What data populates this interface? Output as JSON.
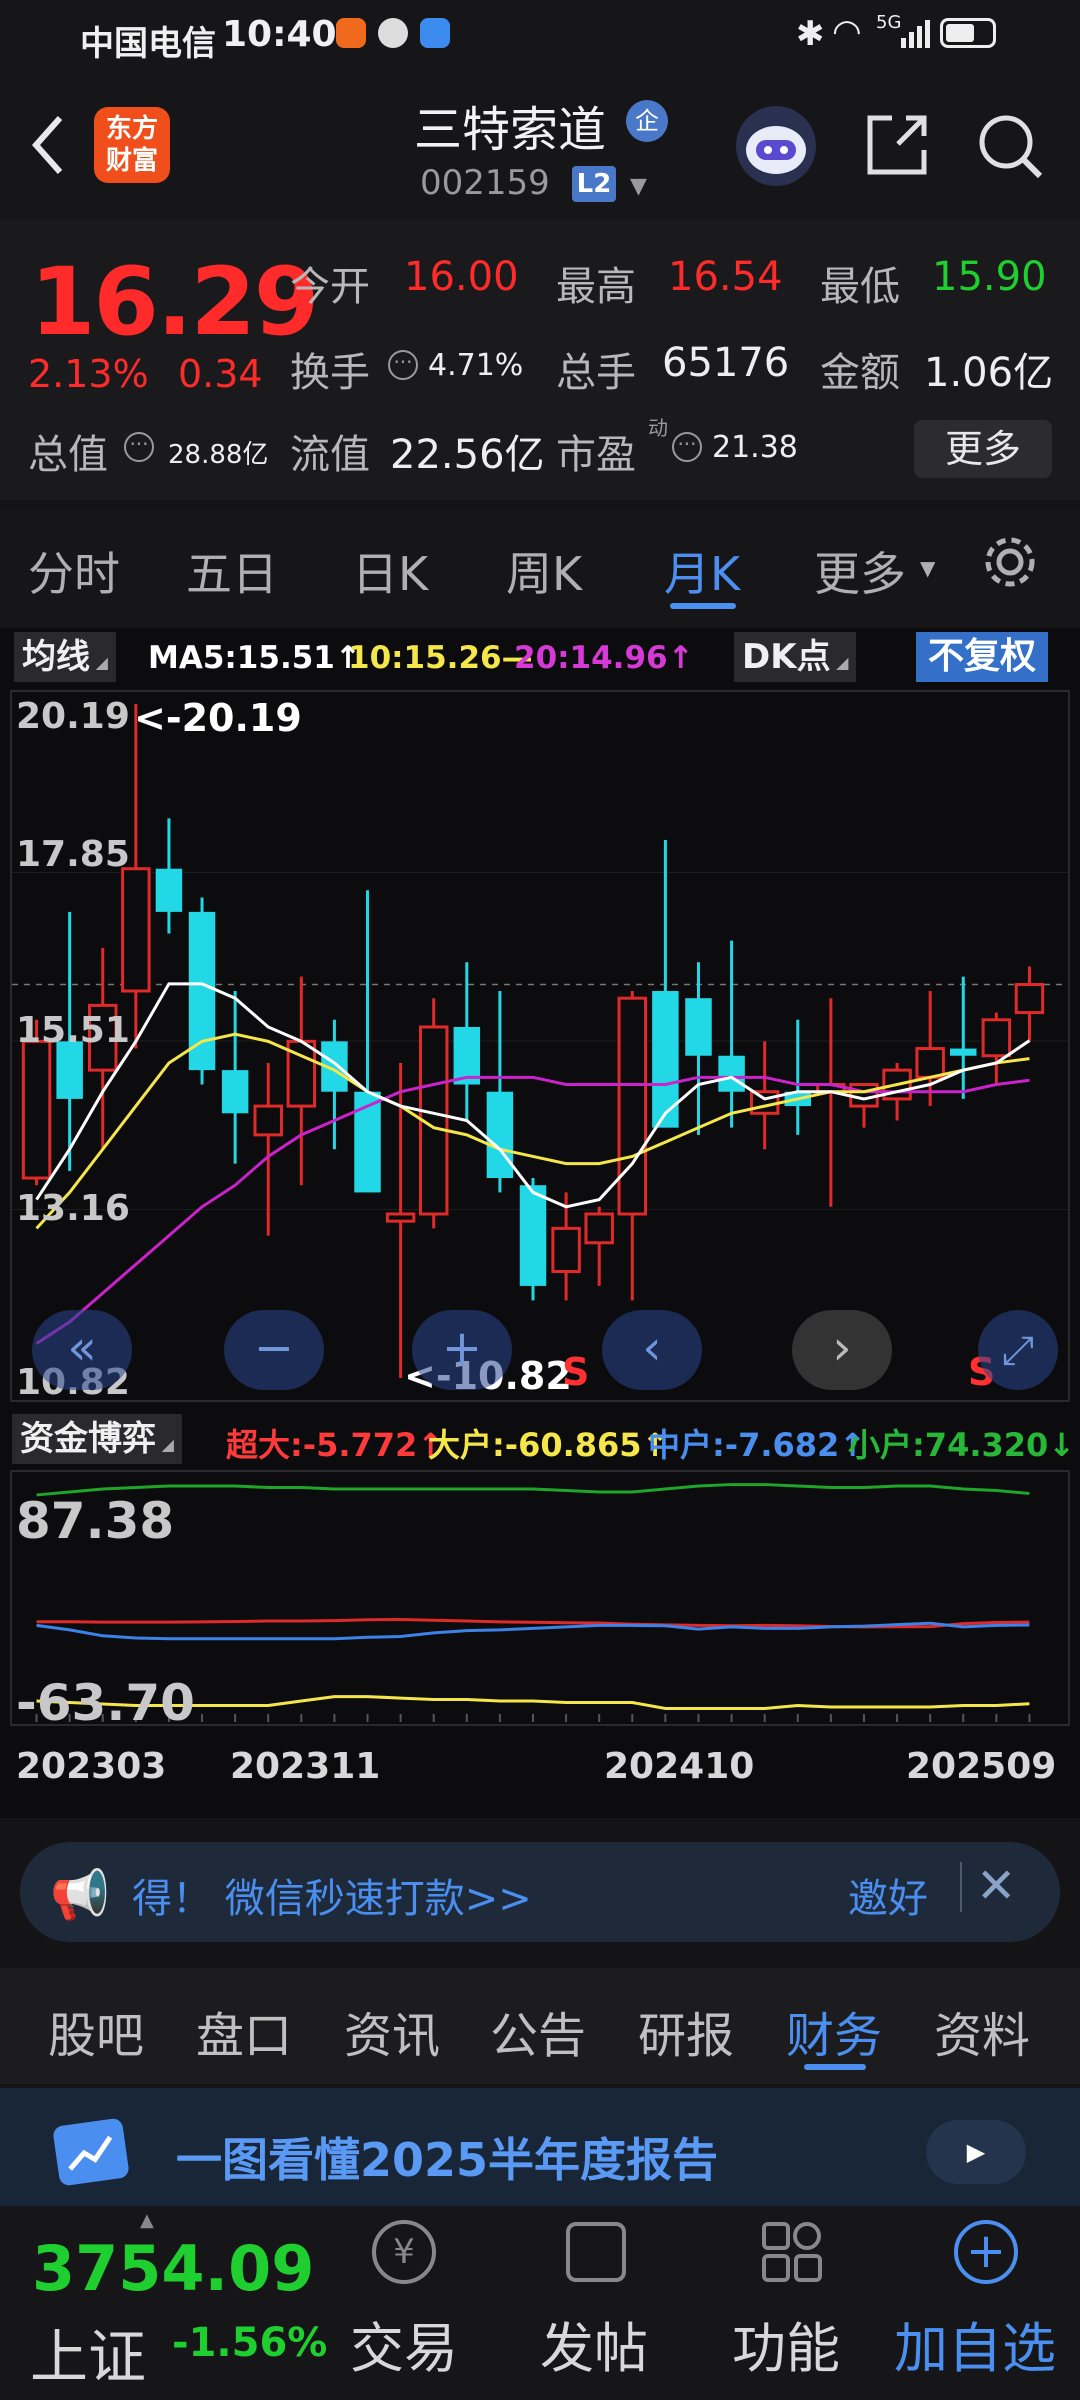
{
  "status_bar": {
    "carrier": "中国电信",
    "time": "10:40",
    "network": "5G"
  },
  "header": {
    "brand_line1": "东方",
    "brand_line2": "财富",
    "stock_name": "三特索道",
    "badge": "企",
    "stock_code": "002159",
    "level_badge": "L2"
  },
  "quote": {
    "price": "16.29",
    "change_pct": "2.13%",
    "change_amt": "0.34",
    "open_label": "今开",
    "open": "16.00",
    "high_label": "最高",
    "high": "16.54",
    "low_label": "最低",
    "low": "15.90",
    "turnover_label": "换手",
    "turnover": "4.71%",
    "volume_label": "总手",
    "volume": "65176",
    "amount_label": "金额",
    "amount": "1.06亿",
    "mktcap_label": "总值",
    "mktcap": "28.88亿",
    "float_label": "流值",
    "float": "22.56亿",
    "pe_label": "市盈",
    "pe_sup": "动",
    "pe": "21.38",
    "more_button": "更多"
  },
  "period_tabs": [
    "分时",
    "五日",
    "日K",
    "周K",
    "月K",
    "更多"
  ],
  "active_tab": "月K",
  "chart": {
    "indicator_tag": "均线",
    "ma5": "MA5:15.51↑",
    "ma10": "10:15.26—",
    "ma20": "20:14.96↑",
    "dk_button": "DK点",
    "adj_button": "不复权",
    "y_labels": [
      "20.19",
      "17.85",
      "15.51",
      "13.16",
      "10.82"
    ],
    "max_marker": "<-20.19",
    "min_marker": "<-10.82",
    "s_marker": "S",
    "colors": {
      "up": "#e02a2a",
      "down": "#22d8e6",
      "ma5": "#ffffff",
      "ma10": "#f5e64a",
      "ma20": "#cc22cc"
    }
  },
  "chart_data": {
    "type": "candlestick",
    "ylim": [
      10.82,
      20.19
    ],
    "candles": [
      {
        "o": 13.6,
        "h": 15.8,
        "l": 13.5,
        "c": 15.5
      },
      {
        "o": 15.5,
        "h": 17.3,
        "l": 13.7,
        "c": 14.7
      },
      {
        "o": 15.1,
        "h": 16.8,
        "l": 14.0,
        "c": 16.0
      },
      {
        "o": 16.2,
        "h": 20.19,
        "l": 15.4,
        "c": 17.9
      },
      {
        "o": 17.9,
        "h": 18.6,
        "l": 17.0,
        "c": 17.3
      },
      {
        "o": 17.3,
        "h": 17.5,
        "l": 14.9,
        "c": 15.1
      },
      {
        "o": 15.1,
        "h": 16.2,
        "l": 13.8,
        "c": 14.5
      },
      {
        "o": 14.2,
        "h": 15.2,
        "l": 12.8,
        "c": 14.6
      },
      {
        "o": 14.6,
        "h": 16.4,
        "l": 13.5,
        "c": 15.5
      },
      {
        "o": 15.5,
        "h": 15.8,
        "l": 14.0,
        "c": 14.8
      },
      {
        "o": 14.8,
        "h": 17.6,
        "l": 13.5,
        "c": 13.4
      },
      {
        "o": 13.0,
        "h": 15.2,
        "l": 10.82,
        "c": 13.1
      },
      {
        "o": 13.1,
        "h": 16.1,
        "l": 12.9,
        "c": 15.7
      },
      {
        "o": 15.7,
        "h": 16.6,
        "l": 14.4,
        "c": 14.9
      },
      {
        "o": 14.8,
        "h": 16.2,
        "l": 13.4,
        "c": 13.6
      },
      {
        "o": 13.5,
        "h": 13.6,
        "l": 11.9,
        "c": 12.1
      },
      {
        "o": 12.3,
        "h": 13.4,
        "l": 11.9,
        "c": 12.9
      },
      {
        "o": 12.7,
        "h": 13.2,
        "l": 12.1,
        "c": 13.1
      },
      {
        "o": 13.1,
        "h": 16.2,
        "l": 11.9,
        "c": 16.1
      },
      {
        "o": 16.2,
        "h": 18.3,
        "l": 16.0,
        "c": 14.3
      },
      {
        "o": 16.1,
        "h": 16.6,
        "l": 14.2,
        "c": 15.3
      },
      {
        "o": 15.3,
        "h": 16.9,
        "l": 14.3,
        "c": 14.8
      },
      {
        "o": 14.5,
        "h": 15.5,
        "l": 14.0,
        "c": 14.8
      },
      {
        "o": 14.8,
        "h": 15.8,
        "l": 14.2,
        "c": 14.6
      },
      {
        "o": 14.8,
        "h": 16.1,
        "l": 13.2,
        "c": 14.9
      },
      {
        "o": 14.6,
        "h": 14.9,
        "l": 14.3,
        "c": 14.9
      },
      {
        "o": 14.7,
        "h": 15.2,
        "l": 14.4,
        "c": 15.1
      },
      {
        "o": 15.0,
        "h": 16.2,
        "l": 14.6,
        "c": 15.4
      },
      {
        "o": 15.4,
        "h": 16.4,
        "l": 14.7,
        "c": 15.3
      },
      {
        "o": 15.3,
        "h": 15.9,
        "l": 14.9,
        "c": 15.8
      },
      {
        "o": 15.9,
        "h": 16.54,
        "l": 15.5,
        "c": 16.29
      }
    ],
    "ma5": [
      13.3,
      14.0,
      14.8,
      15.5,
      16.3,
      16.3,
      16.1,
      15.7,
      15.5,
      15.2,
      14.8,
      14.6,
      14.5,
      14.4,
      14.0,
      13.4,
      13.2,
      13.3,
      13.8,
      14.5,
      14.9,
      15.0,
      14.7,
      14.8,
      14.8,
      14.7,
      14.8,
      14.9,
      15.1,
      15.2,
      15.51
    ],
    "ma10": [
      12.9,
      13.4,
      14.0,
      14.6,
      15.2,
      15.5,
      15.6,
      15.5,
      15.3,
      15.1,
      14.8,
      14.6,
      14.3,
      14.2,
      14.0,
      13.9,
      13.8,
      13.8,
      13.9,
      14.1,
      14.3,
      14.5,
      14.6,
      14.7,
      14.8,
      14.8,
      14.9,
      15.0,
      15.1,
      15.2,
      15.26
    ],
    "ma20": [
      11.3,
      11.6,
      12.0,
      12.4,
      12.8,
      13.2,
      13.5,
      13.9,
      14.2,
      14.4,
      14.6,
      14.8,
      14.9,
      15.0,
      15.0,
      15.0,
      14.9,
      14.9,
      14.9,
      14.9,
      15.0,
      15.0,
      15.0,
      14.9,
      14.9,
      14.8,
      14.8,
      14.8,
      14.8,
      14.9,
      14.96
    ]
  },
  "flow": {
    "tag": "资金博弈",
    "super": "超大:-5.772↑",
    "big": "大户:-60.865↑",
    "mid": "中户:-7.682↑",
    "small": "小户:74.320↓",
    "y_top": "87.38",
    "y_bottom": "-63.70",
    "dates": [
      "202303",
      "202311",
      "202410",
      "202509"
    ],
    "colors": {
      "super": "#e02a2a",
      "big": "#f5e64a",
      "mid": "#3c82e8",
      "small": "#1fa52a"
    }
  },
  "flow_data": {
    "ylim": [
      -63.7,
      87.38
    ],
    "small": [
      80,
      82,
      84,
      85,
      86,
      86,
      86,
      85,
      85,
      84,
      84,
      84,
      84,
      84,
      84,
      84,
      83,
      82,
      82,
      84,
      86,
      87,
      87,
      86,
      85,
      85,
      86,
      86,
      84,
      83,
      81
    ],
    "super": [
      -5.5,
      -5.5,
      -5.8,
      -5.8,
      -5.8,
      -5.6,
      -5.4,
      -5.0,
      -5.0,
      -4.8,
      -4.2,
      -4.0,
      -4.5,
      -5.0,
      -5.6,
      -5.9,
      -6.2,
      -6.4,
      -7.2,
      -7.6,
      -8.0,
      -8.2,
      -8.0,
      -8.2,
      -8.7,
      -9.0,
      -8.9,
      -8.8,
      -6.8,
      -6.0,
      -5.77
    ],
    "big": [
      -59,
      -60,
      -61,
      -62,
      -62,
      -62,
      -62,
      -62,
      -59,
      -56,
      -56,
      -57,
      -58,
      -58,
      -59,
      -59,
      -60,
      -60,
      -60,
      -64,
      -64,
      -64,
      -64,
      -62,
      -63,
      -63,
      -63,
      -63,
      -62,
      -62,
      -60.865
    ],
    "mid": [
      -8.0,
      -11.0,
      -15.0,
      -16.5,
      -17.0,
      -17.0,
      -17.0,
      -17.0,
      -17.0,
      -17.0,
      -16.0,
      -15.5,
      -13.0,
      -11.5,
      -11.0,
      -10.0,
      -9.0,
      -8.0,
      -8.0,
      -8.2,
      -10.5,
      -9.0,
      -10.0,
      -10.0,
      -9.0,
      -8.5,
      -7.5,
      -6.5,
      -9.0,
      -8.0,
      -7.682
    ]
  },
  "banner": {
    "text": "得！ 微信秒速打款>>",
    "right": "邀好"
  },
  "bottom_tabs": [
    "股吧",
    "盘口",
    "资讯",
    "公告",
    "研报",
    "财务",
    "资料"
  ],
  "bottom_active": "财务",
  "report_banner": "一图看懂2025半年度报告",
  "index": {
    "value": "3754.09",
    "name": "上证",
    "change": "-1.56%"
  },
  "nav": [
    "交易",
    "发帖",
    "功能",
    "加自选"
  ]
}
